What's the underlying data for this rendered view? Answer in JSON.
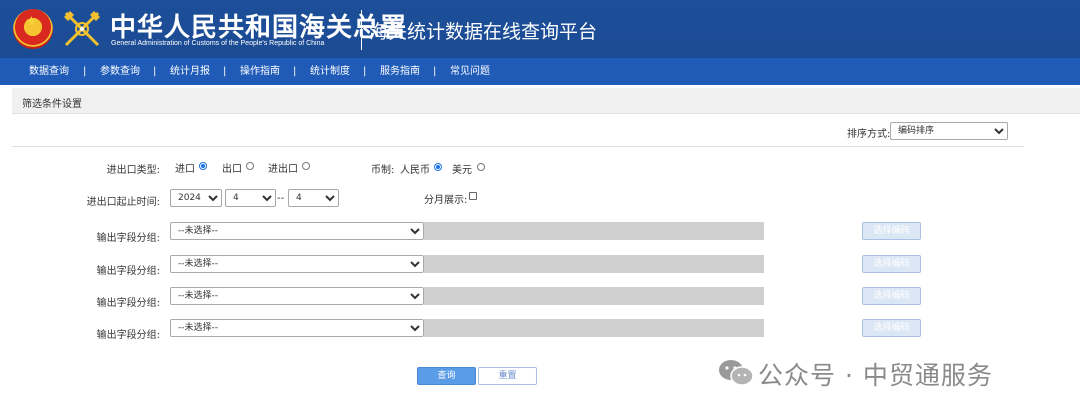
{
  "header": {
    "title_cn": "中华人民共和国海关总署",
    "title_en": "General Administration of Customs of the People's Republic of China",
    "platform": "海关统计数据在线查询平台"
  },
  "nav": {
    "items": [
      {
        "label": "数据查询"
      },
      {
        "label": "参数查询"
      },
      {
        "label": "统计月报"
      },
      {
        "label": "操作指南"
      },
      {
        "label": "统计制度"
      },
      {
        "label": "服务指南"
      },
      {
        "label": "常见问题"
      }
    ],
    "separator": "|"
  },
  "panel": {
    "title": "筛选条件设置",
    "sort_label": "排序方式:",
    "sort_value": "编码排序"
  },
  "filters": {
    "trade_type_label": "进出口类型:",
    "trade_options": [
      {
        "label": "进口",
        "selected": true
      },
      {
        "label": "出口",
        "selected": false
      },
      {
        "label": "进出口",
        "selected": false
      }
    ],
    "currency_label": "币制:",
    "currency_options": [
      {
        "label": "人民币",
        "selected": true
      },
      {
        "label": "美元",
        "selected": false
      }
    ],
    "period_label": "进出口起止时间:",
    "start_year": "2024",
    "start_month": "4",
    "range_sep": "--",
    "end_month": "4",
    "monthly_label": "分月展示:",
    "monthly_checked": false
  },
  "field_groups": {
    "label": "输出字段分组:",
    "placeholder": "--未选择--",
    "pick_label": "选择编码",
    "rows": [
      {
        "value": "--未选择--"
      },
      {
        "value": "--未选择--"
      },
      {
        "value": "--未选择--"
      },
      {
        "value": "--未选择--"
      }
    ]
  },
  "actions": {
    "query_label": "查询",
    "reset_label": "重置"
  },
  "watermark": {
    "text": "公众号 · 中贸通服务"
  },
  "colors": {
    "header_bg": "#1b4b93",
    "nav_bg": "#1f5bb7",
    "query_btn": "#5a9de6",
    "radio_on": "#1a73e8"
  }
}
